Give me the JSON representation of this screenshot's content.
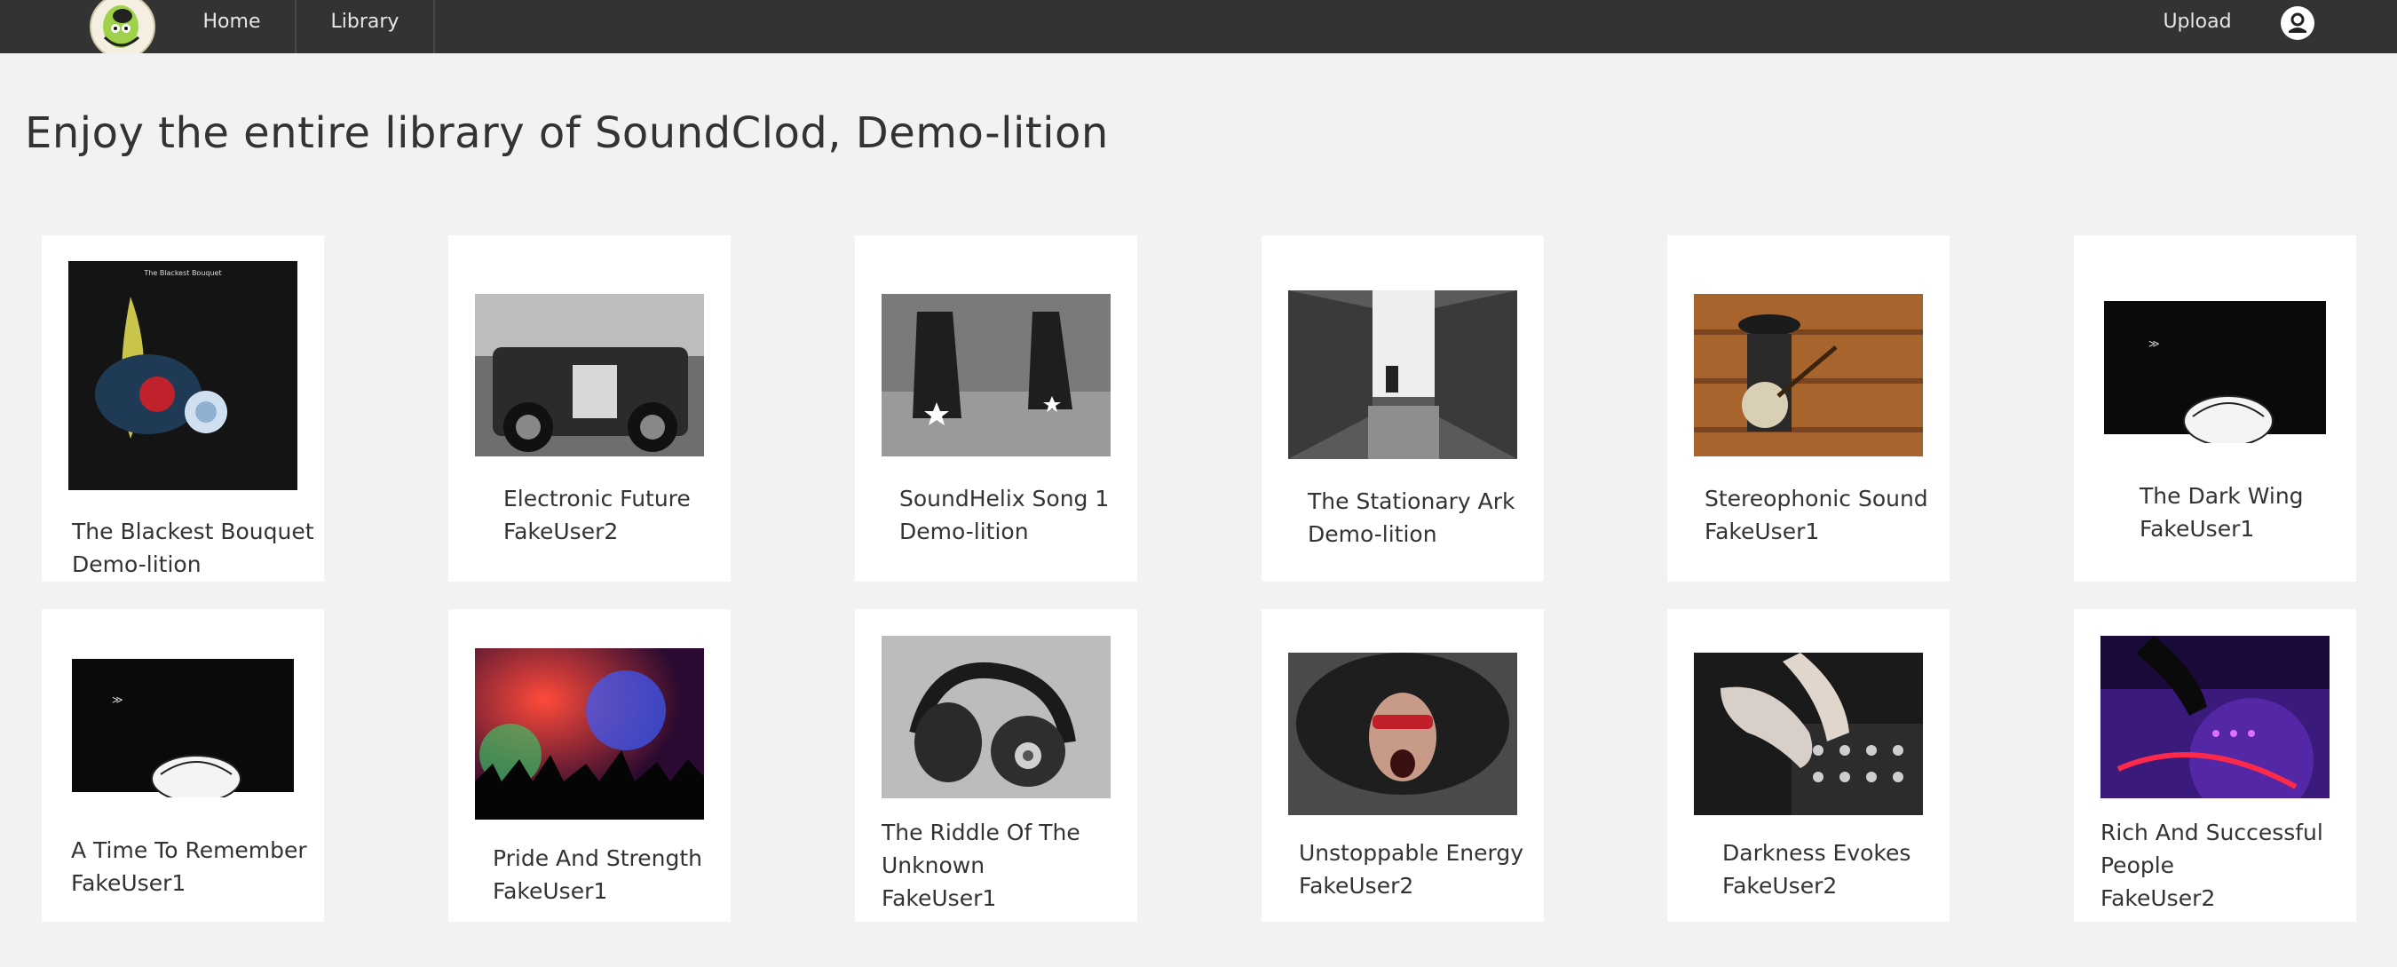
{
  "nav": {
    "home_label": "Home",
    "library_label": "Library",
    "upload_label": "Upload"
  },
  "page_title": "Enjoy the entire library of SoundClod, Demo-lition",
  "songs": [
    {
      "title": "The Blackest Bouquet",
      "artist": "Demo-lition",
      "cover_text": "The Blackest Bouquet"
    },
    {
      "title": "Electronic Future",
      "artist": "FakeUser2"
    },
    {
      "title": "SoundHelix Song 1",
      "artist": "Demo-lition"
    },
    {
      "title": "The Stationary Ark",
      "artist": "Demo-lition"
    },
    {
      "title": "Stereophonic Sound",
      "artist": "FakeUser1"
    },
    {
      "title": "The Dark Wing",
      "artist": "FakeUser1"
    },
    {
      "title": "A Time To Remember",
      "artist": "FakeUser1"
    },
    {
      "title": "Pride And Strength",
      "artist": "FakeUser1"
    },
    {
      "title": "The Riddle Of The Unknown",
      "title_line1": "The Riddle Of The",
      "title_line2": "Unknown",
      "artist": "FakeUser1"
    },
    {
      "title": "Unstoppable Energy",
      "artist": "FakeUser2"
    },
    {
      "title": "Darkness Evokes",
      "artist": "FakeUser2"
    },
    {
      "title": "Rich And Successful People",
      "title_line1": "Rich And Successful",
      "title_line2": "People",
      "artist": "FakeUser2"
    }
  ],
  "colors": {
    "navbar": "#333333",
    "background": "#f2f2f2",
    "card": "#ffffff",
    "text": "#333333"
  }
}
